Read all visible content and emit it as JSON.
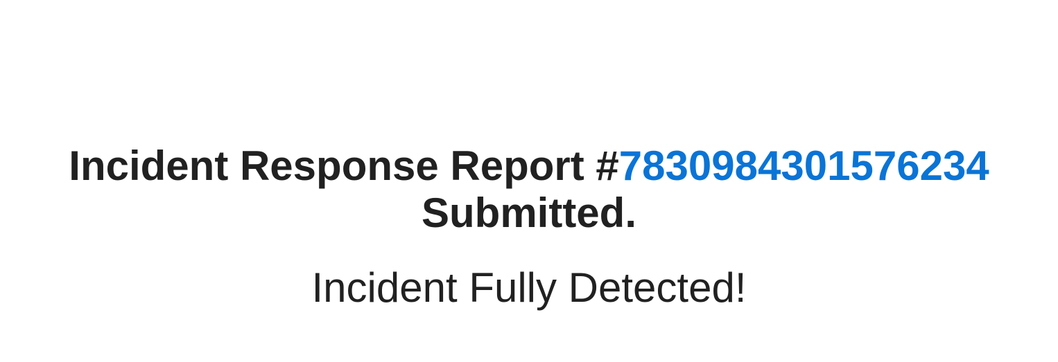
{
  "confirmation": {
    "title_prefix": "Incident Response Report #",
    "report_number": "7830984301576234",
    "title_suffix": "Submitted.",
    "status_message": "Incident Fully Detected!"
  },
  "colors": {
    "text": "#212121",
    "link": "#0a74d6",
    "background": "#ffffff"
  }
}
